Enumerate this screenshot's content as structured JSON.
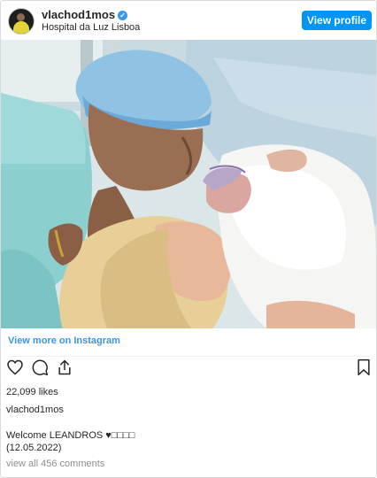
{
  "post": {
    "username": "vlachod1mos",
    "location": "Hospital da Luz Lisboa",
    "view_profile_label": "View profile",
    "view_more_label": "View more on Instagram",
    "likes": "22,099 likes",
    "caption_username": "vlachod1mos",
    "caption_text": "Welcome LEANDROS ♥□□□□",
    "caption_date": "(12.05.2022)",
    "comments_link": "view all 456 comments",
    "accent_color": "#0095f6",
    "link_color": "#3897f0",
    "icons": [
      "verified-badge",
      "heart-icon",
      "comment-icon",
      "share-icon",
      "bookmark-icon"
    ]
  }
}
